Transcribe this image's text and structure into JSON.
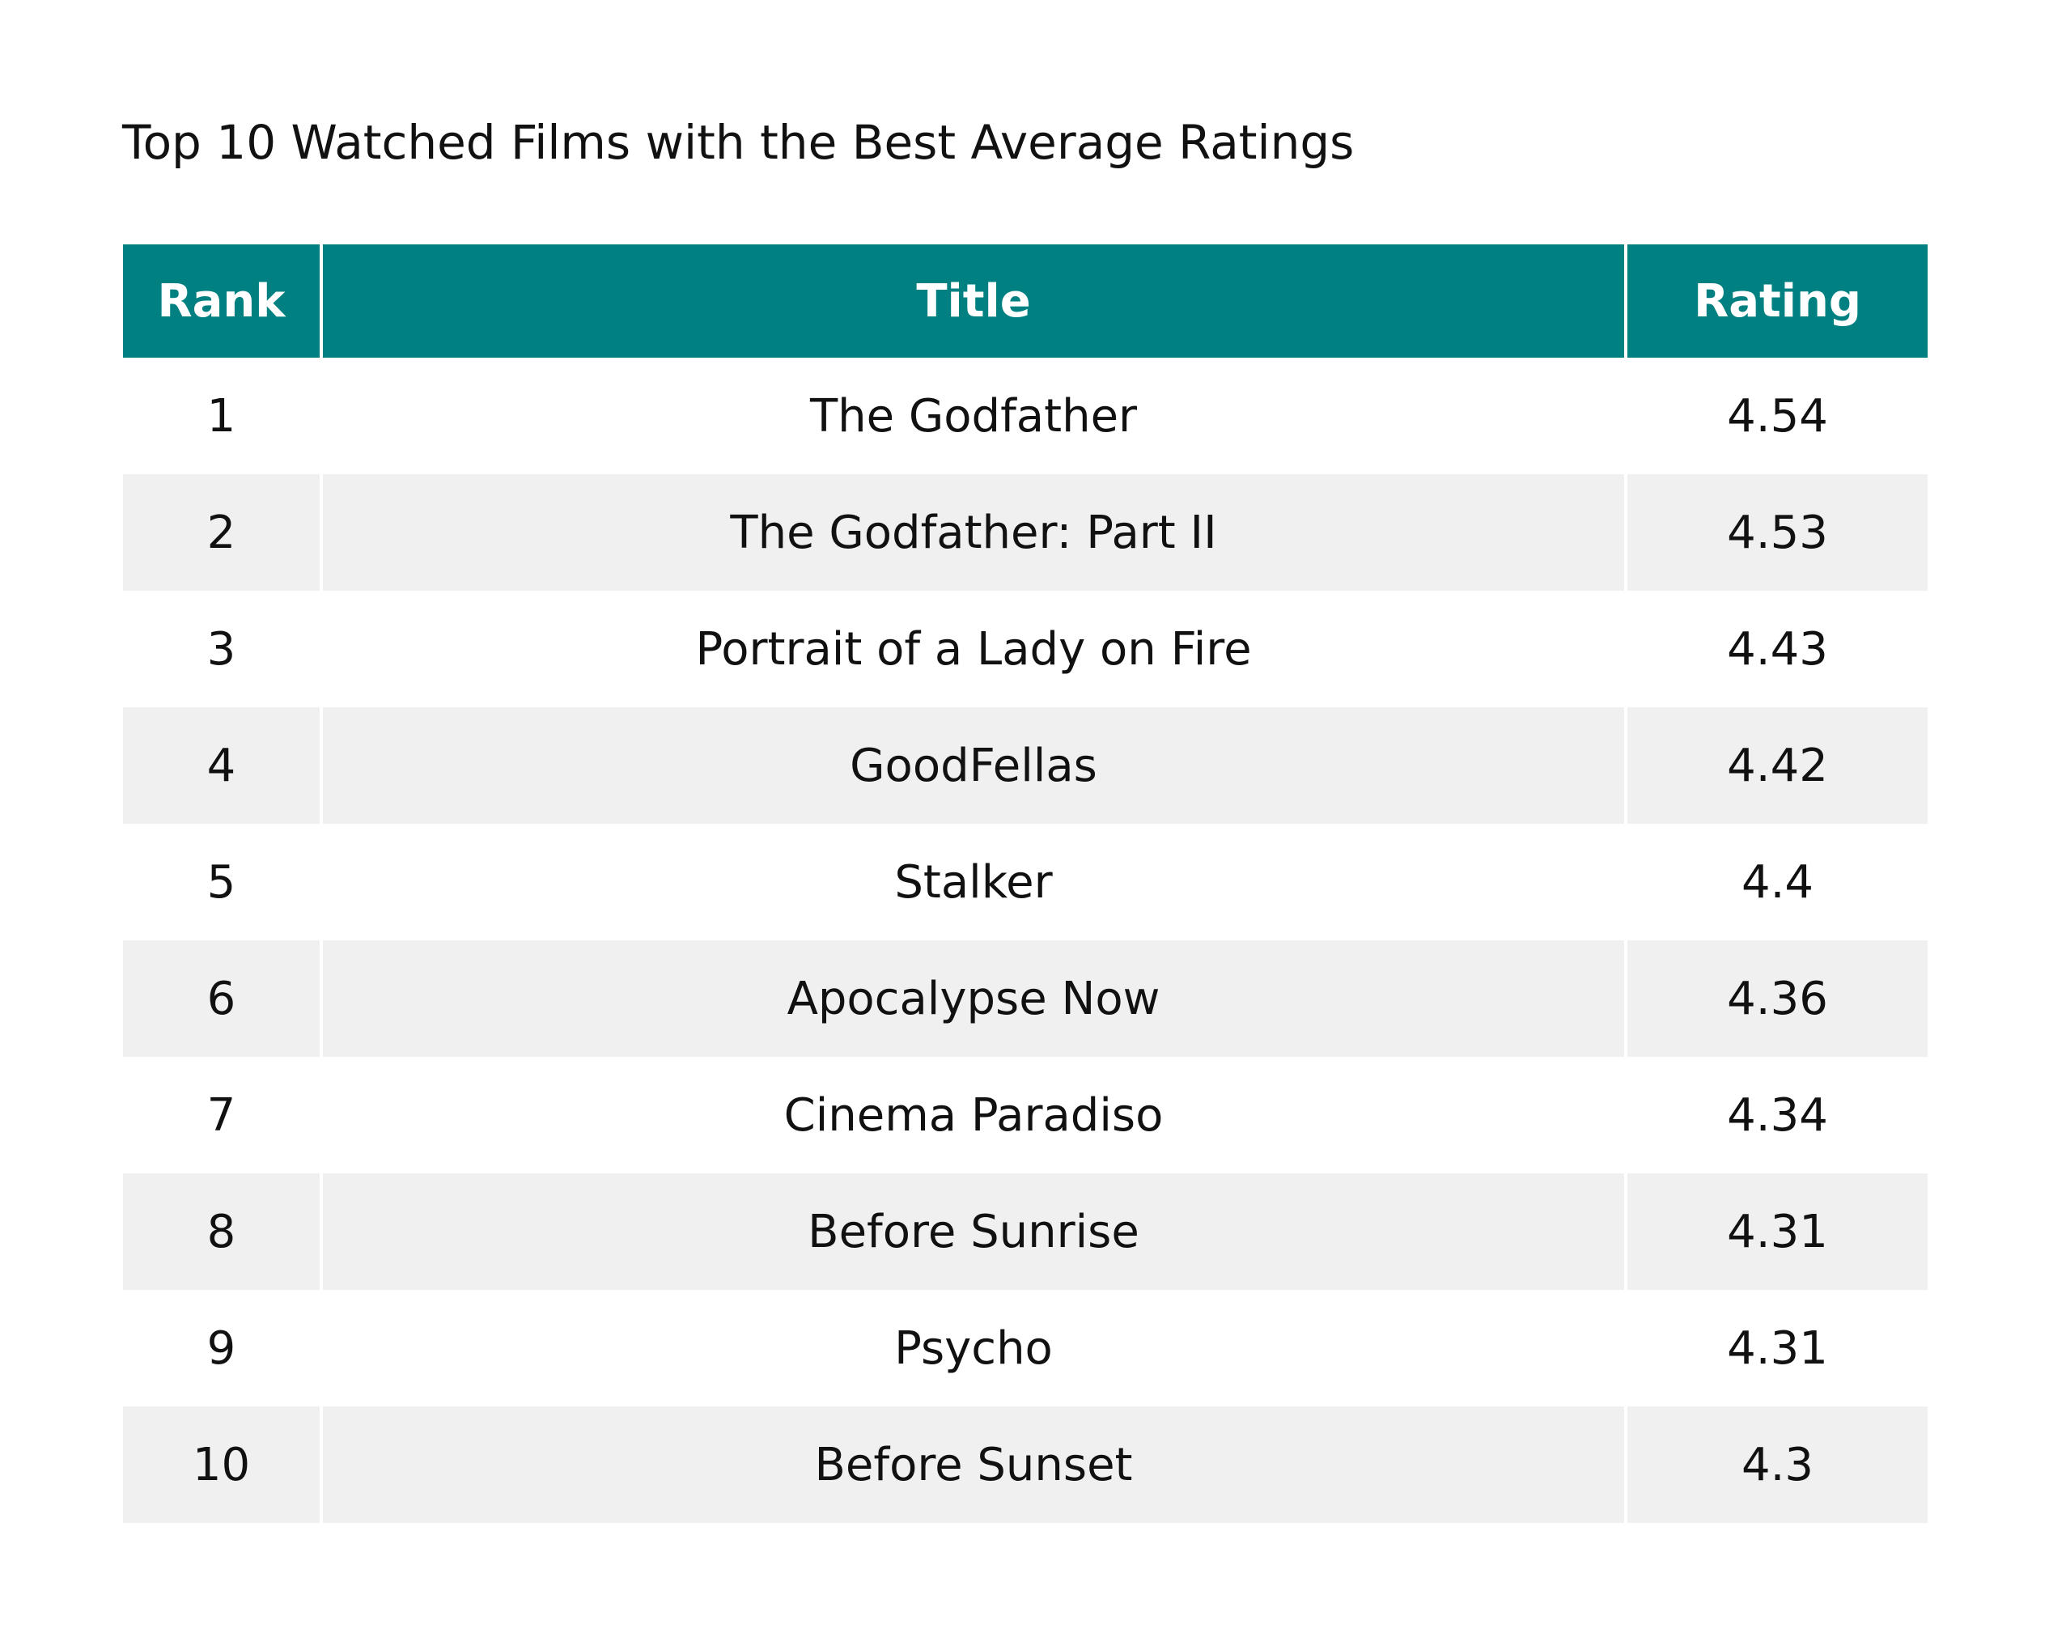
{
  "title": "Top 10 Watched Films with the Best Average Ratings",
  "colors": {
    "header_bg": "#008080",
    "header_text": "#ffffff",
    "row_alt_bg": "#f0f0f0",
    "row_bg": "#ffffff"
  },
  "chart_data": {
    "type": "table",
    "title": "Top 10 Watched Films with the Best Average Ratings",
    "columns": [
      "Rank",
      "Title",
      "Rating"
    ],
    "rows": [
      {
        "rank": "1",
        "title": "The Godfather",
        "rating": "4.54"
      },
      {
        "rank": "2",
        "title": "The Godfather: Part II",
        "rating": "4.53"
      },
      {
        "rank": "3",
        "title": "Portrait of a Lady on Fire",
        "rating": "4.43"
      },
      {
        "rank": "4",
        "title": "GoodFellas",
        "rating": "4.42"
      },
      {
        "rank": "5",
        "title": "Stalker",
        "rating": "4.4"
      },
      {
        "rank": "6",
        "title": "Apocalypse Now",
        "rating": "4.36"
      },
      {
        "rank": "7",
        "title": "Cinema Paradiso",
        "rating": "4.34"
      },
      {
        "rank": "8",
        "title": "Before Sunrise",
        "rating": "4.31"
      },
      {
        "rank": "9",
        "title": "Psycho",
        "rating": "4.31"
      },
      {
        "rank": "10",
        "title": "Before Sunset",
        "rating": "4.3"
      }
    ]
  }
}
